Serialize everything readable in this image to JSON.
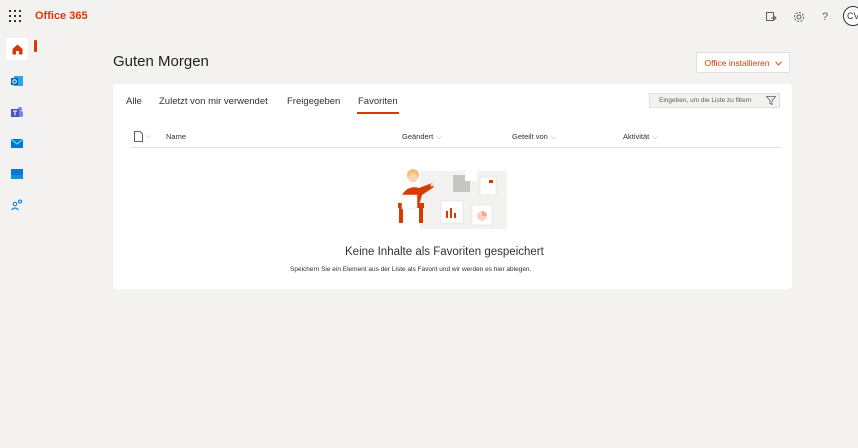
{
  "topbar": {
    "brand": "Office 365",
    "icons": [
      "waffle-icon",
      "feedback-icon",
      "settings-icon",
      "help-icon"
    ],
    "help_label": "?",
    "avatar_initials": "CV"
  },
  "rail": {
    "items": [
      "home",
      "outlook",
      "teams",
      "mail",
      "sharepoint",
      "people"
    ]
  },
  "main": {
    "greeting": "Guten Morgen",
    "install_button": "Office installieren",
    "tabs": [
      {
        "label": "Alle"
      },
      {
        "label": "Zuletzt von mir verwendet"
      },
      {
        "label": "Freigegeben"
      },
      {
        "label": "Favoriten"
      }
    ],
    "active_tab": "Favoriten",
    "filter_placeholder": "Eingeben, um die Liste zu filtern",
    "columns": {
      "name": "Name",
      "changed": "Geändert",
      "shared_by": "Geteilt von",
      "activity": "Aktivität"
    },
    "empty_title": "Keine Inhalte als Favoriten gespeichert",
    "empty_subtitle": "Speichern Sie ein Element aus der Liste als Favorit und wir werden es hier ablegen."
  },
  "colors": {
    "accent": "#d83b01",
    "background": "#f3f2f1",
    "card": "#ffffff"
  }
}
